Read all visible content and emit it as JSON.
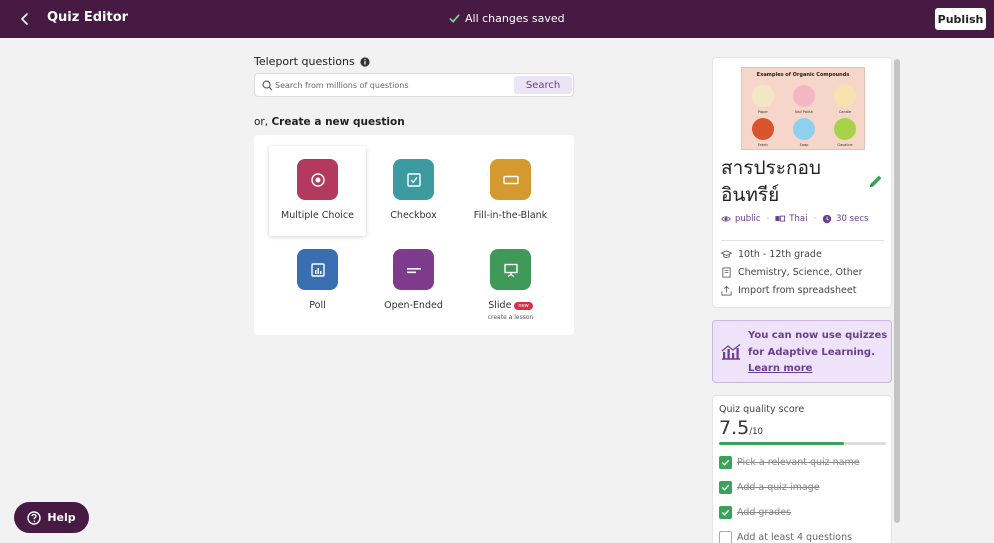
{
  "header": {
    "title": "Quiz Editor",
    "saved_status": "All changes saved",
    "publish_label": "Publish"
  },
  "teleport": {
    "title": "Teleport questions",
    "search_placeholder": "Search from millions of questions",
    "search_label": "Search"
  },
  "create": {
    "prefix": "or,",
    "title": "Create a new question",
    "types": [
      {
        "label": "Multiple Choice",
        "color": "#b3395e",
        "icon": "radio-target-icon"
      },
      {
        "label": "Checkbox",
        "color": "#3c9aa1",
        "icon": "checkbox-icon"
      },
      {
        "label": "Fill-in-the-Blank",
        "color": "#d49a30",
        "icon": "blank-box-icon"
      },
      {
        "label": "Poll",
        "color": "#3a6eb3",
        "icon": "bar-chart-icon"
      },
      {
        "label": "Open-Ended",
        "color": "#7e3a8c",
        "icon": "text-lines-icon"
      },
      {
        "label": "Slide",
        "color": "#3f9a5a",
        "icon": "presentation-icon",
        "badge": "new",
        "sub": "create a lesson"
      }
    ]
  },
  "quiz": {
    "image_title": "Examples of Organic Compounds",
    "image_labels": [
      "Paper",
      "Nail Polish",
      "Candle",
      "Fabric",
      "Soap",
      "Gasoline"
    ],
    "name": "สารประกอบอินทรีย์",
    "visibility": "public",
    "language": "Thai",
    "duration": "30 secs",
    "grade": "10th - 12th grade",
    "subjects": "Chemistry, Science, Other",
    "import": "Import from spreadsheet"
  },
  "adaptive": {
    "text": "You can now use quizzes for Adaptive Learning.",
    "link": "Learn more"
  },
  "quality": {
    "title": "Quiz quality score",
    "score": "7.5",
    "max": "/10",
    "score_fraction": 0.75,
    "items": [
      {
        "label": "Pick a relevant quiz name",
        "done": true
      },
      {
        "label": "Add a quiz image",
        "done": true
      },
      {
        "label": "Add grades",
        "done": true
      },
      {
        "label": "Add at least 4 questions",
        "done": false
      }
    ]
  },
  "help": {
    "label": "Help"
  },
  "colors": {
    "brand": "#461a42",
    "accent": "#6a3e92",
    "success": "#3aa35a"
  }
}
